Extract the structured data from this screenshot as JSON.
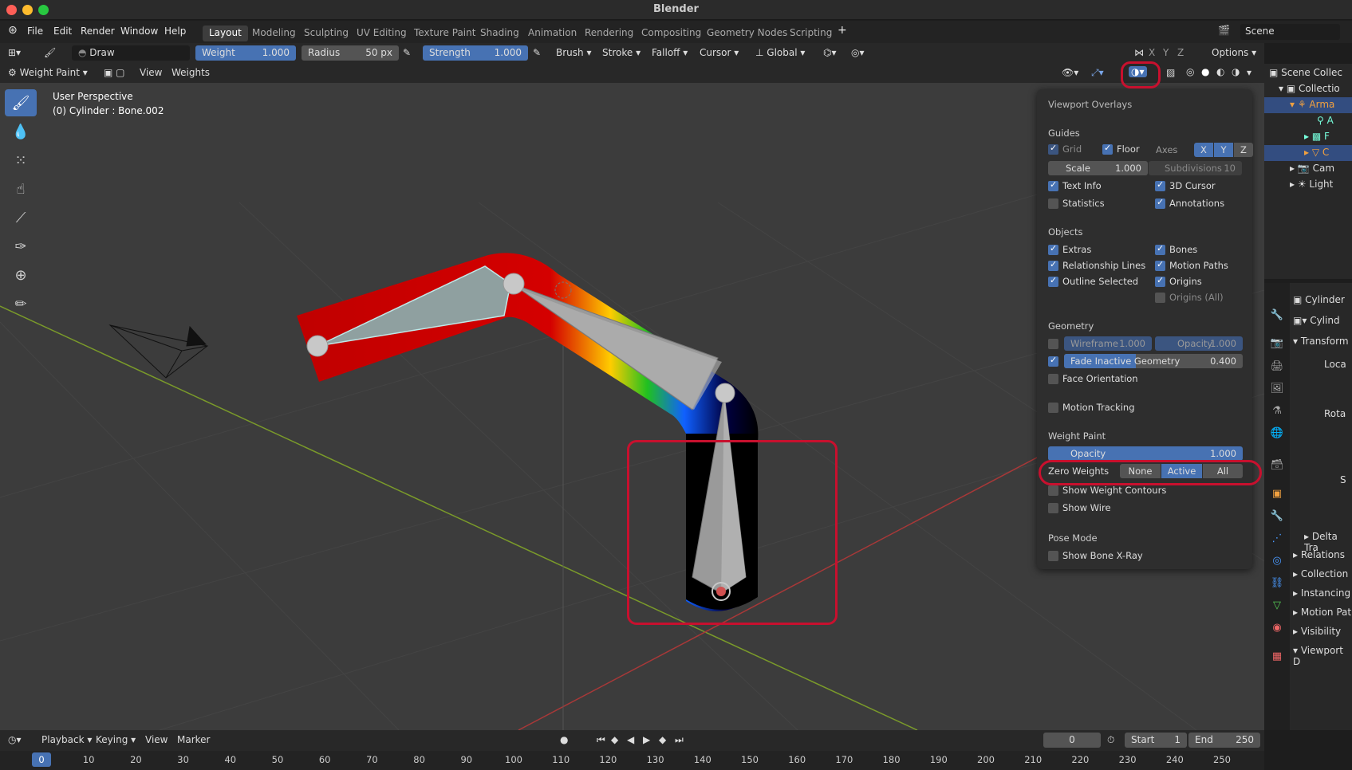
{
  "window": {
    "title": "Blender"
  },
  "menu": {
    "items": [
      "File",
      "Edit",
      "Render",
      "Window",
      "Help"
    ]
  },
  "workspaces": [
    "Layout",
    "Modeling",
    "Sculpting",
    "UV Editing",
    "Texture Paint",
    "Shading",
    "Animation",
    "Rendering",
    "Compositing",
    "Geometry Nodes",
    "Scripting"
  ],
  "active_workspace": "Layout",
  "scene": {
    "label": "Scene"
  },
  "tool_header": {
    "brush_name": "Draw",
    "weight": {
      "label": "Weight",
      "value": "1.000"
    },
    "radius": {
      "label": "Radius",
      "value": "50 px"
    },
    "strength": {
      "label": "Strength",
      "value": "1.000"
    },
    "dropdowns": [
      "Brush",
      "Stroke",
      "Falloff",
      "Cursor"
    ],
    "orientation": "Global",
    "axes": [
      "X",
      "Y",
      "Z"
    ],
    "options": "Options"
  },
  "editor_header": {
    "mode": "Weight Paint",
    "menus": [
      "View",
      "Weights"
    ]
  },
  "viewport": {
    "perspective": "User Perspective",
    "object_info": "(0) Cylinder : Bone.002"
  },
  "overlays": {
    "title": "Viewport Overlays",
    "guides": {
      "heading": "Guides",
      "grid": "Grid",
      "floor": "Floor",
      "axes_label": "Axes",
      "axes": [
        "X",
        "Y",
        "Z"
      ],
      "scale": {
        "label": "Scale",
        "value": "1.000"
      },
      "subdivisions": {
        "label": "Subdivisions",
        "value": "10"
      },
      "text_info": "Text Info",
      "cursor_3d": "3D Cursor",
      "statistics": "Statistics",
      "annotations": "Annotations"
    },
    "objects": {
      "heading": "Objects",
      "extras": "Extras",
      "bones": "Bones",
      "relationship_lines": "Relationship Lines",
      "motion_paths": "Motion Paths",
      "outline_selected": "Outline Selected",
      "origins": "Origins",
      "origins_all": "Origins (All)"
    },
    "geometry": {
      "heading": "Geometry",
      "wireframe": {
        "label": "Wireframe",
        "value": "1.000"
      },
      "opacity": {
        "label": "Opacity",
        "value": "1.000"
      },
      "fade_inactive": {
        "label": "Fade Inactive Geometry",
        "value": "0.400",
        "level": 0.4
      },
      "face_orientation": "Face Orientation",
      "motion_tracking": "Motion Tracking"
    },
    "weight_paint": {
      "heading": "Weight Paint",
      "opacity": {
        "label": "Opacity",
        "value": "1.000"
      },
      "zero_weights_label": "Zero Weights",
      "zero_weights_options": [
        "None",
        "Active",
        "All"
      ],
      "zero_weights_selected": "Active",
      "show_weight_contours": "Show Weight Contours",
      "show_wire": "Show Wire"
    },
    "pose_mode": {
      "heading": "Pose Mode",
      "show_bone_xray": "Show Bone X-Ray"
    }
  },
  "outliner": {
    "items": [
      "Scene Collec",
      "Collectio",
      "Arma",
      "A",
      "F",
      "C",
      "Cam",
      "Light"
    ]
  },
  "properties": {
    "object": "Cylinder",
    "object_field": "Cylind",
    "transform": "Transform",
    "location": "Loca",
    "rotation": "Rota",
    "scale": "S",
    "panels": [
      "Delta Tra",
      "Relations",
      "Collection",
      "Instancing",
      "Motion Pat",
      "Visibility",
      "Viewport D"
    ]
  },
  "timeline": {
    "menus": [
      "Playback",
      "Keying",
      "View",
      "Marker"
    ],
    "current_frame": "0",
    "start": {
      "label": "Start",
      "value": "1"
    },
    "end": {
      "label": "End",
      "value": "250"
    },
    "ticks": [
      "0",
      "10",
      "20",
      "30",
      "40",
      "50",
      "60",
      "70",
      "80",
      "90",
      "100",
      "110",
      "120",
      "130",
      "140",
      "150",
      "160",
      "170",
      "180",
      "190",
      "200",
      "210",
      "220",
      "230",
      "240",
      "250"
    ]
  },
  "colors": {
    "accent": "#4772b3",
    "highlight": "#c8102e"
  }
}
